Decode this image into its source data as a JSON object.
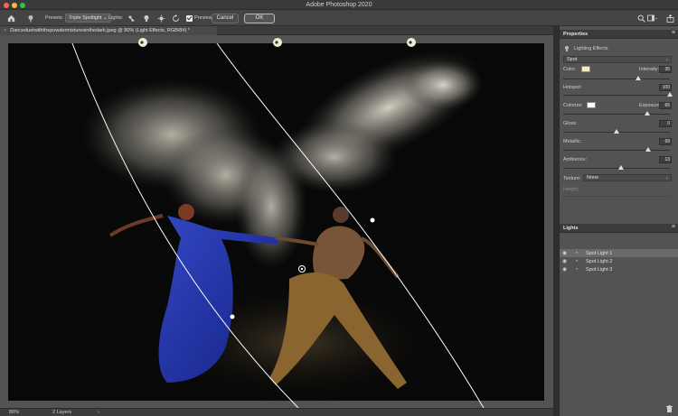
{
  "window": {
    "title": "Adobe Photoshop 2020"
  },
  "options_bar": {
    "presets_label": "Presets:",
    "presets_value": "Triple Spotlight",
    "lights_label": "Lights:",
    "preview_label": "Preview",
    "cancel_label": "Cancel",
    "ok_label": "OK"
  },
  "document": {
    "tab_title": "Danceduetwiththepowdermixturesinthedark.jpeg @ 80% (Light Effects, RGB/8#) *",
    "close_glyph": "×"
  },
  "status": {
    "zoom": "80%",
    "layers": "2 Layers",
    "arrow": "›"
  },
  "properties": {
    "panel_title": "Properties",
    "subtitle": "Lighting Effects",
    "light_type": "Spot",
    "color_label": "Color:",
    "color_value": "#f3ecc7",
    "intensity_label": "Intensity:",
    "intensity": "35",
    "intensity_level": 0.7,
    "hotspot_label": "Hotspot:",
    "hotspot": "100",
    "hotspot_level": 1.0,
    "colorize_label": "Colorize:",
    "colorize_value": "#ffffff",
    "exposure_label": "Exposure:",
    "exposure": "65",
    "exposure_level": 0.79,
    "gloss_label": "Gloss:",
    "gloss": "0",
    "gloss_level": 0.5,
    "metallic_label": "Metallic:",
    "metallic": "69",
    "metallic_level": 0.8,
    "ambience_label": "Ambience:",
    "ambience": "13",
    "ambience_level": 0.54,
    "texture_label": "Texture:",
    "texture_value": "None",
    "height_label": "Height:"
  },
  "lights_panel": {
    "title": "Lights",
    "items": [
      {
        "label": "Spot Light 1",
        "selected": true
      },
      {
        "label": "Spot Light 2",
        "selected": false
      },
      {
        "label": "Spot Light 3",
        "selected": false
      }
    ]
  },
  "icons": {
    "home": "home-icon",
    "light_pin": "light-pin-icon",
    "add_spot": "add-spot-light-icon",
    "add_point": "add-point-light-icon",
    "add_infinite": "add-infinite-light-icon",
    "reset": "reset-icon",
    "search": "search-icon",
    "workspace": "workspace-icon",
    "share": "share-icon",
    "trash": "trash-icon",
    "eye": "eye-icon"
  },
  "colors": {
    "accent_panel": "#535353",
    "canvas_bg": "#080808",
    "dress_blue": "#2638a8"
  }
}
